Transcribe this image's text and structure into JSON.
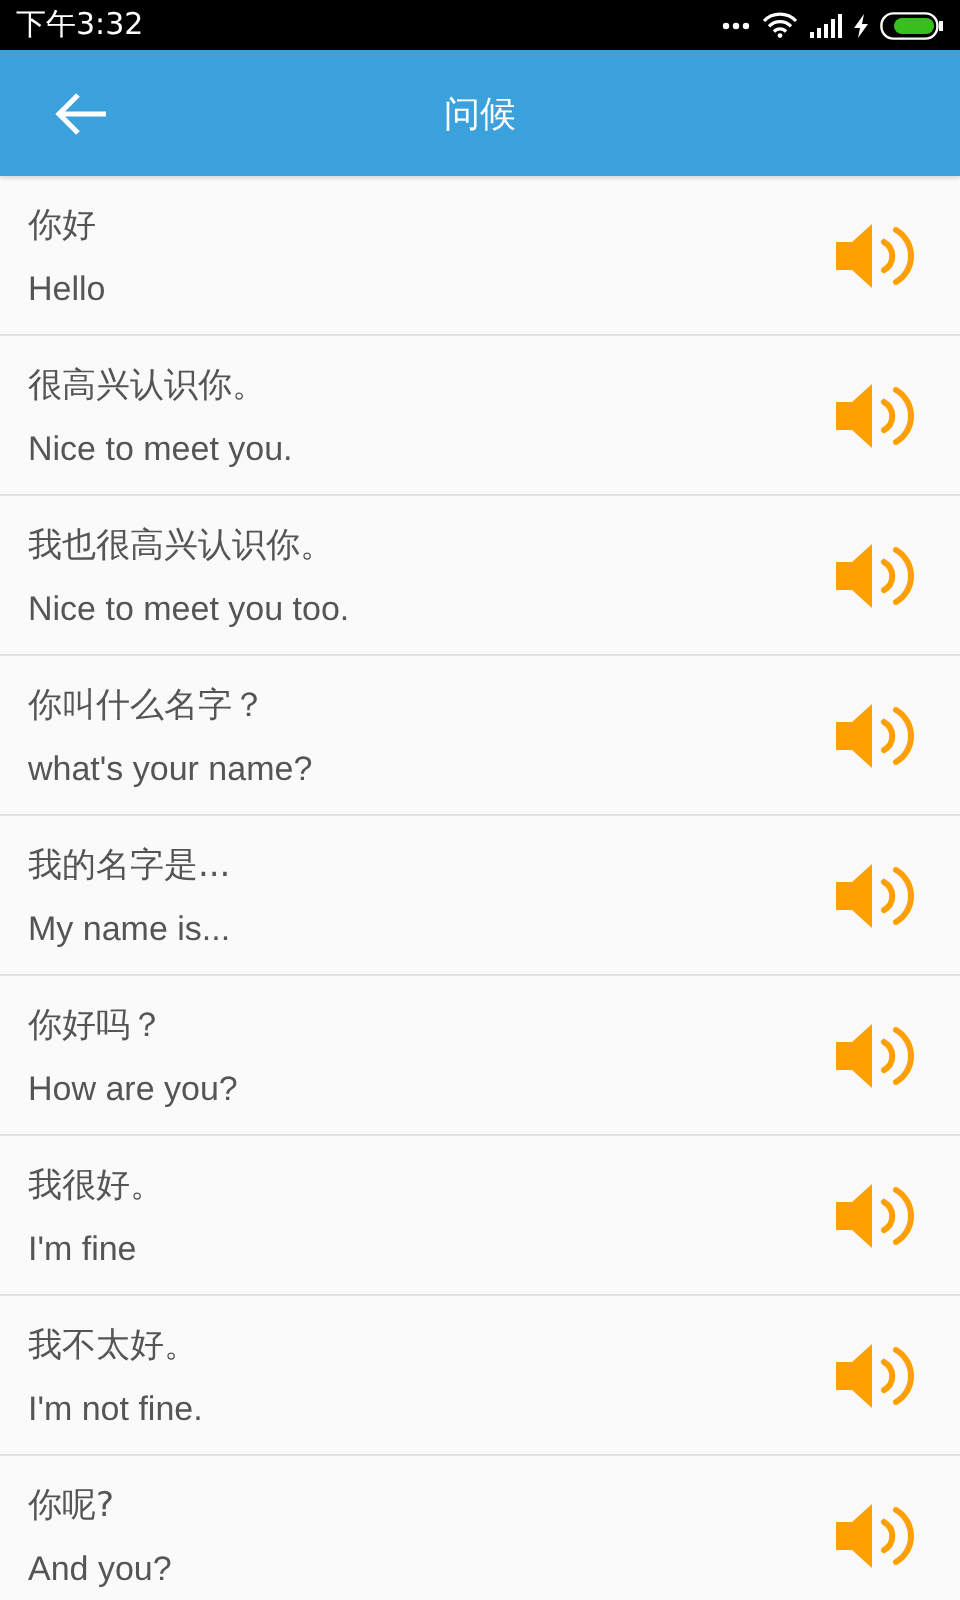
{
  "status_bar": {
    "time": "下午3:32"
  },
  "header": {
    "title": "问候"
  },
  "phrases": [
    {
      "chinese": "你好",
      "english": "Hello"
    },
    {
      "chinese": "很高兴认识你。",
      "english": "Nice to meet you."
    },
    {
      "chinese": "我也很高兴认识你。",
      "english": "Nice to meet you too."
    },
    {
      "chinese": "你叫什么名字？",
      "english": "what's your name?"
    },
    {
      "chinese": "我的名字是...",
      "english": "My name is..."
    },
    {
      "chinese": "你好吗？",
      "english": "How are you?"
    },
    {
      "chinese": "我很好。",
      "english": "I'm fine"
    },
    {
      "chinese": "我不太好。",
      "english": "I'm not fine."
    },
    {
      "chinese": "你呢?",
      "english": "And you?"
    }
  ]
}
